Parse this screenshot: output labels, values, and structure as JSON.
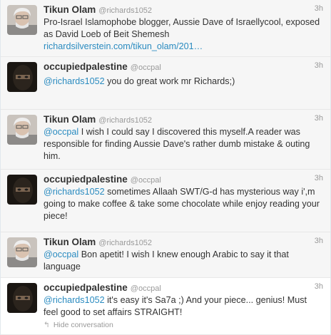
{
  "tweets": [
    {
      "author": "Tikun Olam",
      "handle": "@richards1052",
      "time": "3h",
      "avatar": "grey-haired-man-photo",
      "text_prefix": "Pro-Israel Islamophobe blogger, Aussie Dave of Israellycool, exposed as David Loeb of Beit Shemesh",
      "link": "richardsilverstein.com/tikun_olam/201…"
    },
    {
      "author": "occupiedpalestine",
      "handle": "@occpal",
      "time": "3h",
      "avatar": "veiled-woman-photo",
      "mention": "@richards1052",
      "text": " you do great work mr Richards;)"
    },
    {
      "author": "Tikun Olam",
      "handle": "@richards1052",
      "time": "3h",
      "avatar": "grey-haired-man-photo",
      "mention": "@occpal",
      "text": " I wish I could say I discovered this myself.A reader was responsible for finding Aussie Dave's rather dumb mistake & outing him."
    },
    {
      "author": "occupiedpalestine",
      "handle": "@occpal",
      "time": "3h",
      "avatar": "veiled-woman-photo",
      "mention": "@richards1052",
      "text": " sometimes Allaah SWT/G-d has mysterious way i',m going to make coffee & take some chocolate while enjoy reading your piece!"
    },
    {
      "author": "Tikun Olam",
      "handle": "@richards1052",
      "time": "3h",
      "avatar": "grey-haired-man-photo",
      "mention": "@occpal",
      "text": " Bon apetit! I wish I knew enough Arabic to say it that language"
    },
    {
      "author": "occupiedpalestine",
      "handle": "@occpal",
      "time": "3h",
      "avatar": "veiled-woman-photo",
      "mention": "@richards1052",
      "text": " it's easy it's Sa7a ;) And your piece... genius! Must feel good to set affairs STRAIGHT!"
    }
  ],
  "hide_conversation": "Hide conversation",
  "colors": {
    "link": "#2a8bc0",
    "conversation_bg": "#f6f6f6",
    "meta_text": "#999999"
  }
}
